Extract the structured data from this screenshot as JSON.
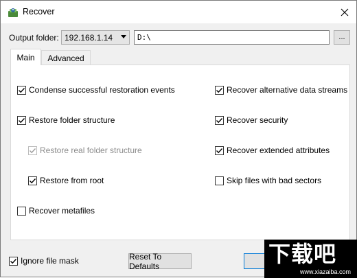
{
  "window": {
    "title": "Recover"
  },
  "output": {
    "label": "Output folder:",
    "combo_value": "192.168.1.14",
    "path_value": "D:\\",
    "browse_label": "..."
  },
  "tabs": [
    {
      "label": "Main",
      "selected": true
    },
    {
      "label": "Advanced",
      "selected": false
    }
  ],
  "options": {
    "condense": {
      "label": "Condense successful restoration events",
      "checked": true
    },
    "restore_folder": {
      "label": "Restore folder structure",
      "checked": true
    },
    "restore_real": {
      "label": "Restore real folder structure",
      "checked": true,
      "disabled": true
    },
    "restore_root": {
      "label": "Restore from root",
      "checked": true
    },
    "recover_metafiles": {
      "label": "Recover metafiles",
      "checked": false
    },
    "recover_ads": {
      "label": "Recover alternative data streams",
      "checked": true
    },
    "recover_security": {
      "label": "Recover security",
      "checked": true
    },
    "recover_extended": {
      "label": "Recover extended attributes",
      "checked": true
    },
    "skip_bad": {
      "label": "Skip files with bad sectors",
      "checked": false
    }
  },
  "footer": {
    "ignore_mask": {
      "label": "Ignore file mask",
      "checked": true
    },
    "reset_label": "Reset To Defaults"
  },
  "watermark": {
    "big": "下载吧",
    "small": "www.xiazaiba.com"
  },
  "colors": {
    "check": "#000000",
    "disabled_text": "#8b8b8b",
    "panel": "#ffffff",
    "dialog": "#f0f0f0"
  }
}
